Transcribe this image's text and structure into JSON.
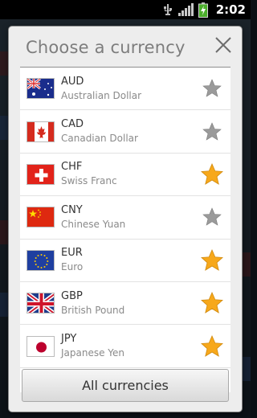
{
  "status_bar": {
    "time": "2:02",
    "icons": [
      "usb-icon",
      "signal-icon",
      "battery-charging-icon"
    ]
  },
  "dialog": {
    "title": "Choose a currency",
    "close_icon": "close-icon",
    "currencies": [
      {
        "code": "AUD",
        "name": "Australian Dollar",
        "flag": "australia",
        "favorite": false
      },
      {
        "code": "CAD",
        "name": "Canadian Dollar",
        "flag": "canada",
        "favorite": false
      },
      {
        "code": "CHF",
        "name": "Swiss Franc",
        "flag": "switzerland",
        "favorite": true
      },
      {
        "code": "CNY",
        "name": "Chinese Yuan",
        "flag": "china",
        "favorite": false
      },
      {
        "code": "EUR",
        "name": "Euro",
        "flag": "european-union",
        "favorite": true
      },
      {
        "code": "GBP",
        "name": "British Pound",
        "flag": "united-kingdom",
        "favorite": true
      },
      {
        "code": "JPY",
        "name": "Japanese Yen",
        "flag": "japan",
        "favorite": true
      }
    ],
    "all_button_label": "All currencies"
  },
  "colors": {
    "star_favorite": "#f7a81b",
    "star_default": "#9a9a9a",
    "dialog_bg": "#ededed",
    "title_text": "#7d7d7d"
  }
}
